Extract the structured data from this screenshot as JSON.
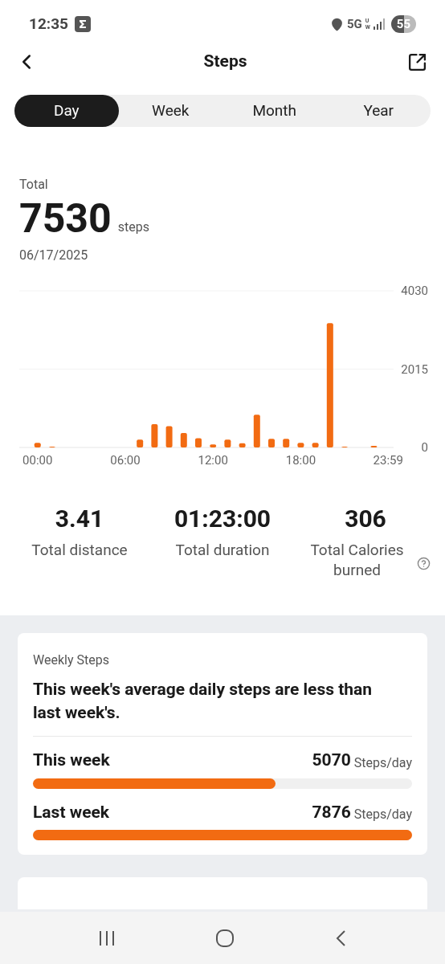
{
  "status_bar": {
    "time": "12:35",
    "network": "5G",
    "network_sub": "UW",
    "battery": "55"
  },
  "header": {
    "title": "Steps"
  },
  "tabs": [
    {
      "label": "Day",
      "selected": true
    },
    {
      "label": "Week",
      "selected": false
    },
    {
      "label": "Month",
      "selected": false
    },
    {
      "label": "Year",
      "selected": false
    }
  ],
  "summary": {
    "label": "Total",
    "value": "7530",
    "unit": "steps",
    "date": "06/17/2025",
    "chart_data": {
      "type": "bar",
      "x": [
        0,
        1,
        2,
        3,
        4,
        5,
        6,
        7,
        8,
        9,
        10,
        11,
        12,
        13,
        14,
        15,
        16,
        17,
        18,
        19,
        20,
        21,
        22,
        23
      ],
      "values": [
        120,
        20,
        0,
        0,
        0,
        0,
        0,
        200,
        600,
        550,
        370,
        240,
        80,
        200,
        110,
        840,
        220,
        220,
        120,
        120,
        3200,
        20,
        0,
        40
      ],
      "xlim": [
        -1.25,
        24.35
      ],
      "ylim": [
        0,
        4030
      ],
      "yticks": [
        0,
        2015,
        4030
      ],
      "xticks": [
        {
          "value": 0,
          "label": "00:00"
        },
        {
          "value": 6,
          "label": "06:00"
        },
        {
          "value": 12,
          "label": "12:00"
        },
        {
          "value": 18,
          "label": "18:00"
        },
        {
          "value": 23.98,
          "label": "23:59"
        }
      ]
    }
  },
  "stats": [
    {
      "value": "3.41",
      "label": "Total distance",
      "help": false
    },
    {
      "value": "01:23:00",
      "label": "Total duration",
      "help": false
    },
    {
      "value": "306",
      "label": "Total Calories burned",
      "help": true
    }
  ],
  "weekly": {
    "title": "Weekly Steps",
    "message": "This week's average daily steps are less than last week's.",
    "rows": [
      {
        "label": "This week",
        "value": "5070",
        "unit": "Steps/day",
        "level": 0.64
      },
      {
        "label": "Last week",
        "value": "7876",
        "unit": "Steps/day",
        "level": 1
      }
    ]
  }
}
